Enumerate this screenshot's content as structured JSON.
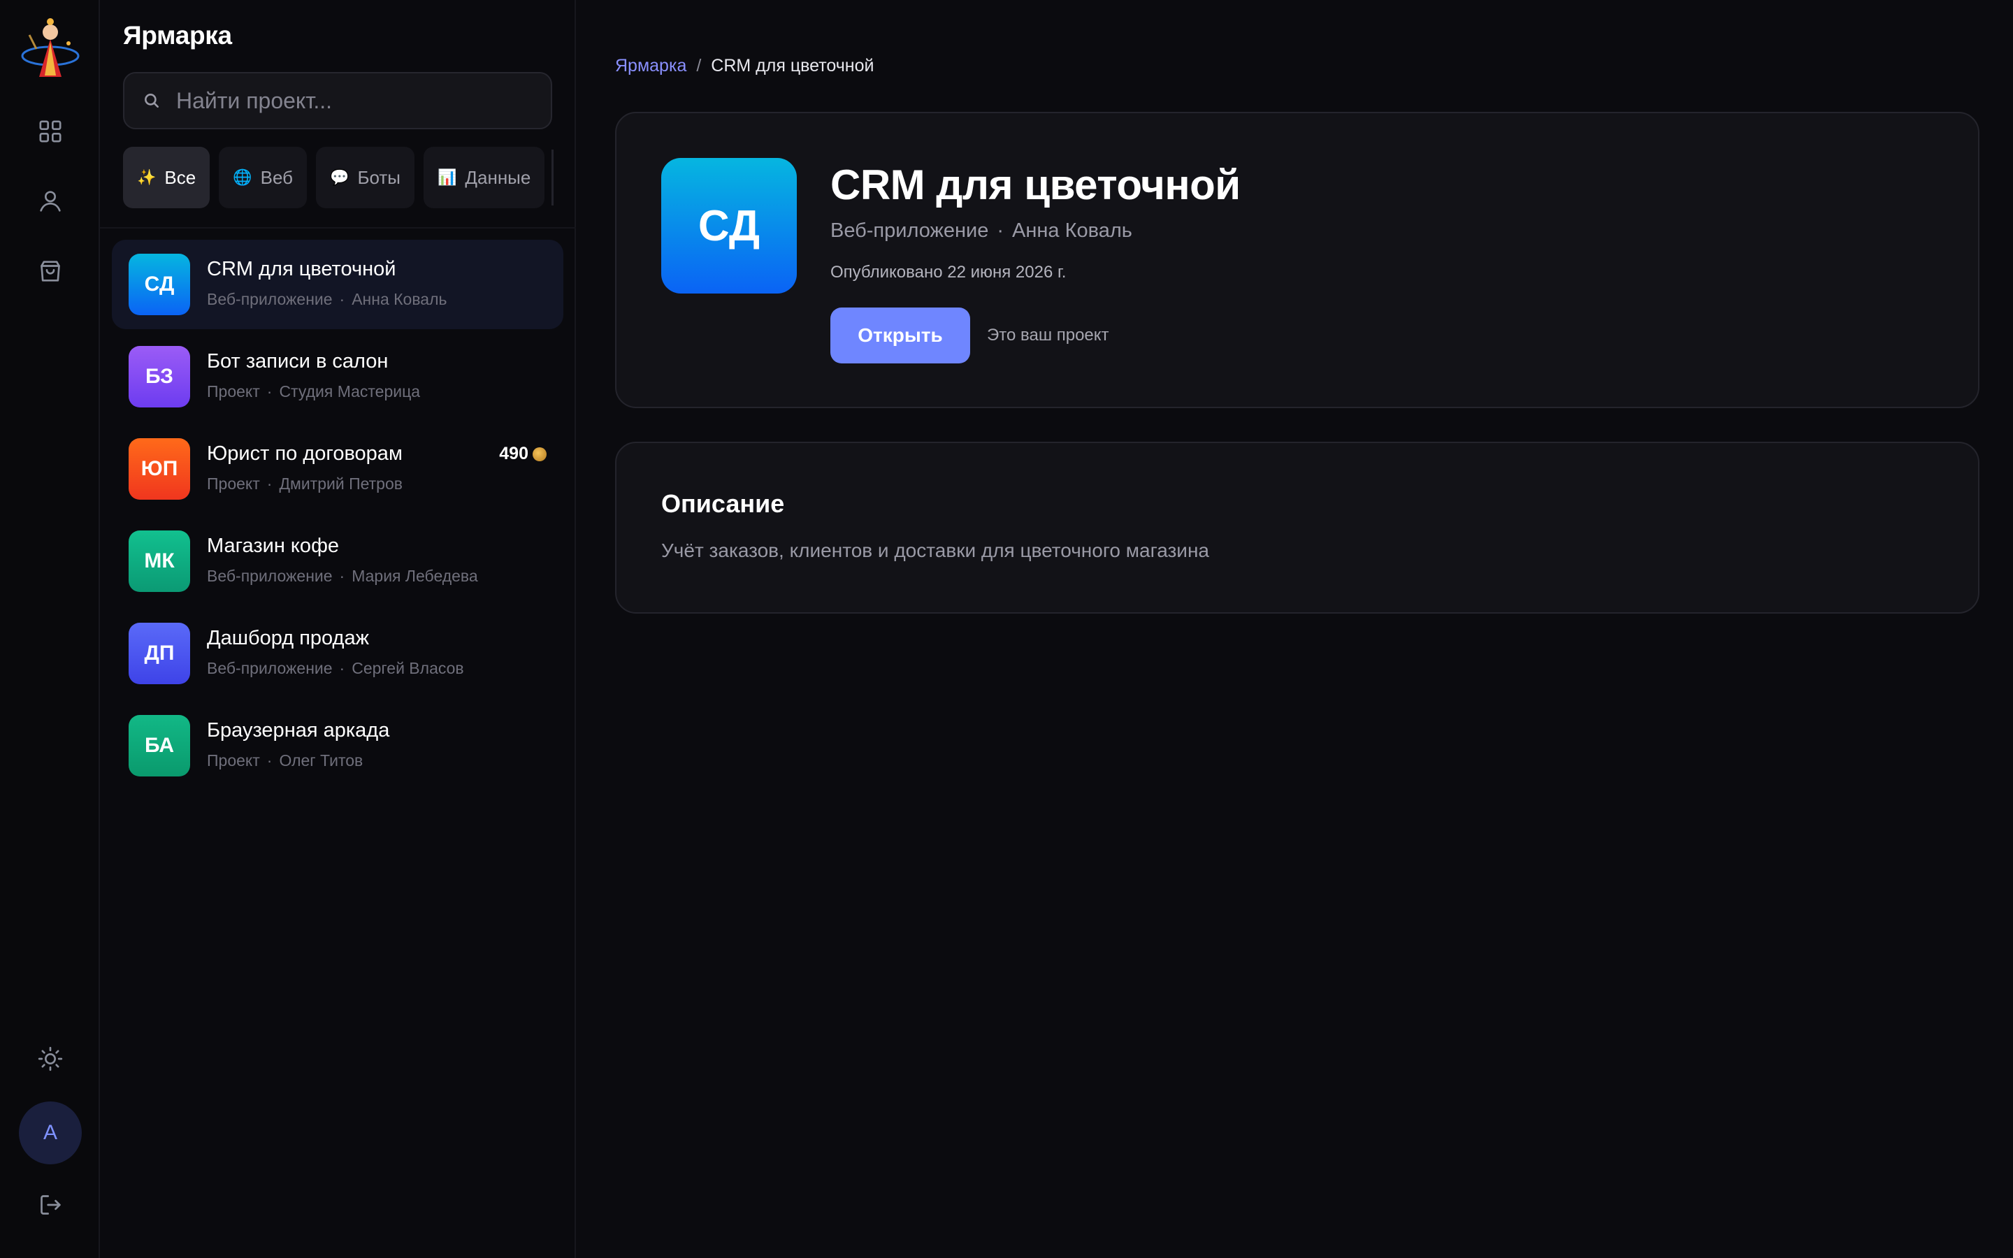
{
  "rail": {
    "nav_icons": [
      "grid-icon",
      "user-icon",
      "shopping-bag-icon"
    ],
    "bottom_icons": [
      "sun-icon",
      "logout-icon"
    ],
    "avatar_letter": "А"
  },
  "sidebar": {
    "title": "Ярмарка",
    "search_placeholder": "Найти проект...",
    "filters": [
      {
        "icon": "✨",
        "label": "Все",
        "active": true
      },
      {
        "icon": "🌐",
        "label": "Веб",
        "active": false
      },
      {
        "icon": "💬",
        "label": "Боты",
        "active": false
      },
      {
        "icon": "📊",
        "label": "Данные",
        "active": false
      }
    ],
    "items": [
      {
        "initials": "СД",
        "title": "CRM для цветочной",
        "type": "Веб-приложение",
        "author": "Анна Коваль",
        "color_from": "#06b6e0",
        "color_to": "#0a63f5",
        "selected": true
      },
      {
        "initials": "БЗ",
        "title": "Бот записи в салон",
        "type": "Проект",
        "author": "Студия Мастерица",
        "color_from": "#9b5cf6",
        "color_to": "#6d3cf0"
      },
      {
        "initials": "ЮП",
        "title": "Юрист по договорам",
        "type": "Проект",
        "author": "Дмитрий Петров",
        "price": "490",
        "color_from": "#ff6a1a",
        "color_to": "#f0361e"
      },
      {
        "initials": "МК",
        "title": "Магазин кофе",
        "type": "Веб-приложение",
        "author": "Мария Лебедева",
        "color_from": "#12c08f",
        "color_to": "#0b9a74"
      },
      {
        "initials": "ДП",
        "title": "Дашборд продаж",
        "type": "Веб-приложение",
        "author": "Сергей Власов",
        "color_from": "#5a6af8",
        "color_to": "#3e43e8"
      },
      {
        "initials": "БА",
        "title": "Браузерная аркада",
        "type": "Проект",
        "author": "Олег Титов",
        "color_from": "#12b886",
        "color_to": "#0a9a6d"
      }
    ]
  },
  "main": {
    "breadcrumb": {
      "home": "Ярмарка",
      "separator": "/",
      "current": "CRM для цветочной"
    },
    "hero": {
      "initials": "СД",
      "title": "CRM для цветочной",
      "type": "Веб-приложение",
      "author": "Анна Коваль",
      "published": "Опубликовано 22 июня 2026 г.",
      "open_label": "Открыть",
      "own_note": "Это ваш проект"
    },
    "description": {
      "title": "Описание",
      "text": "Учёт заказов, клиентов и доставки для цветочного магазина"
    },
    "accent_color": "#6f86ff"
  }
}
